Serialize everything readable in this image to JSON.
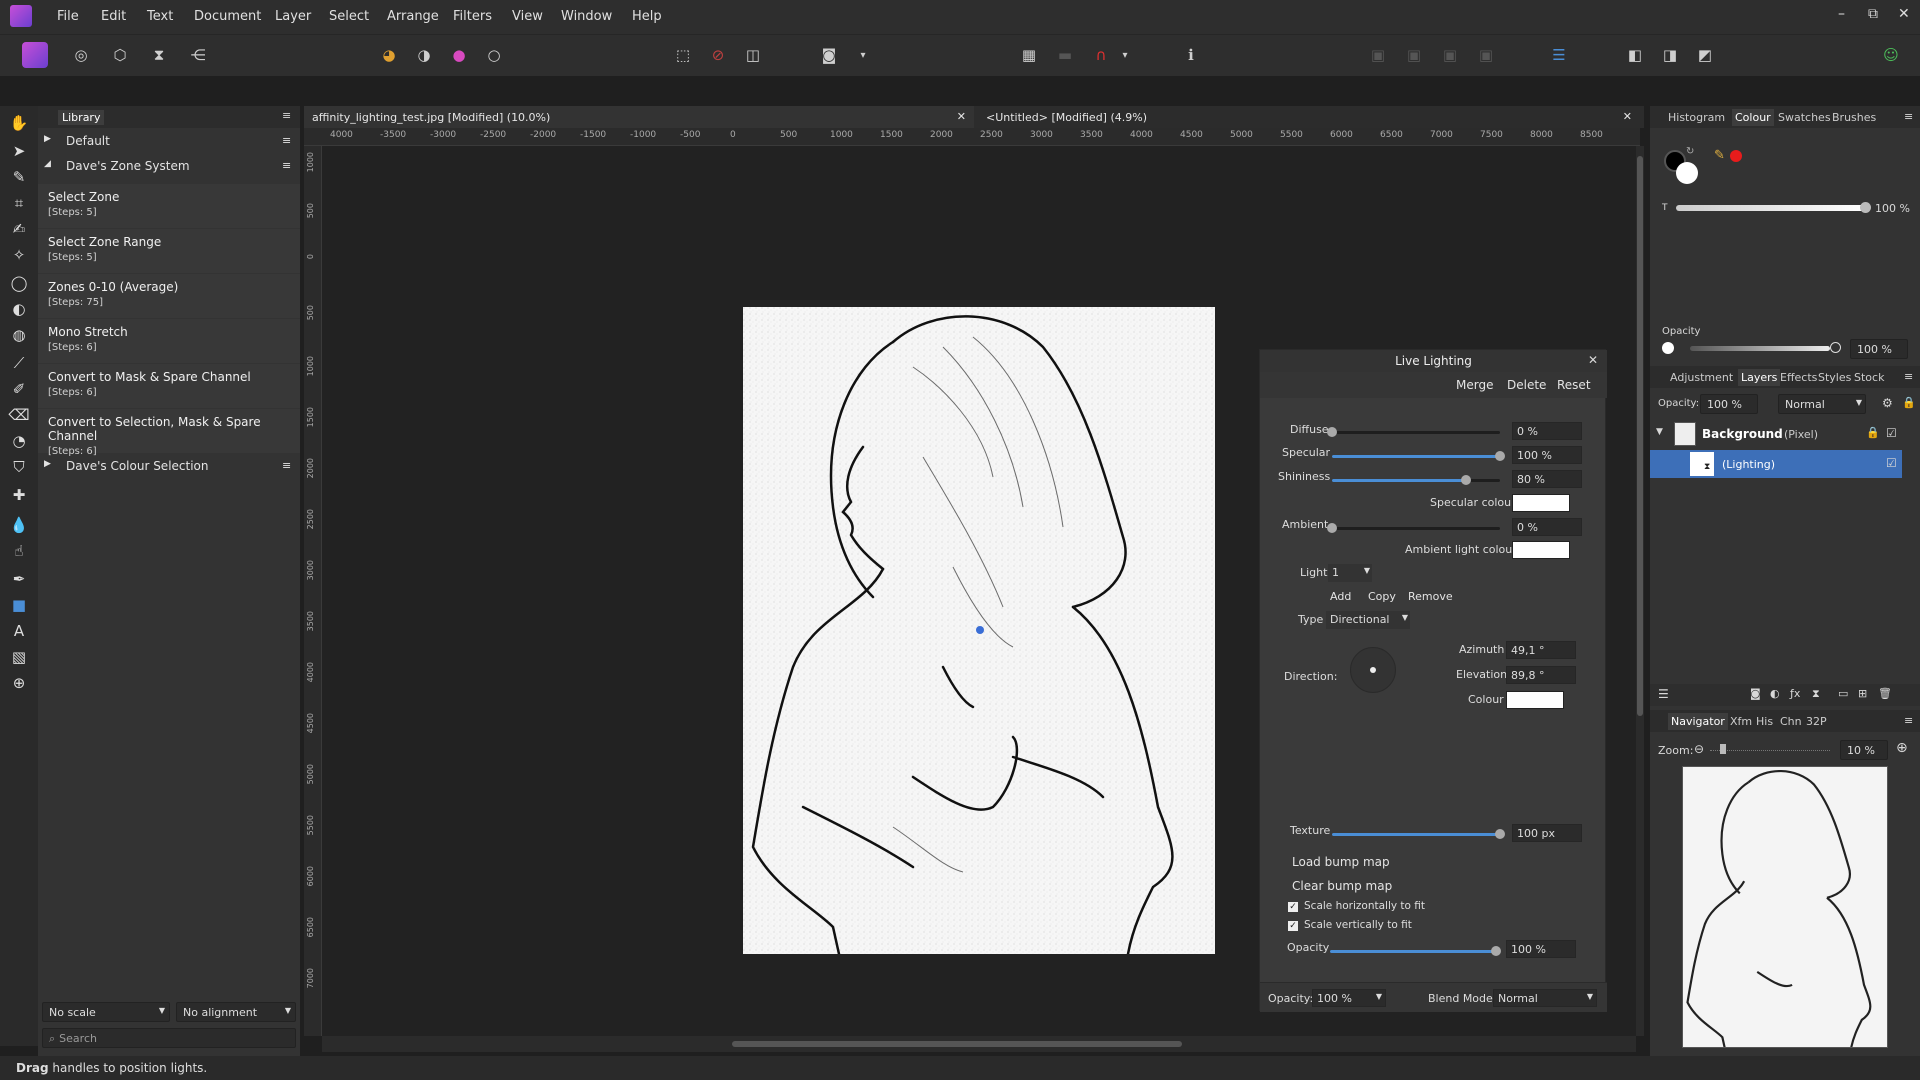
{
  "menu": [
    "File",
    "Edit",
    "Text",
    "Document",
    "Layer",
    "Select",
    "Arrange",
    "Filters",
    "View",
    "Window",
    "Help"
  ],
  "window_controls": [
    "–",
    "⧉",
    "✕"
  ],
  "library": {
    "title": "Library",
    "groups": {
      "default": "Default",
      "daves_zone": "Dave's Zone System",
      "daves_colour": "Dave's Colour Selection"
    },
    "macros": [
      {
        "name": "Select Zone",
        "steps": "[Steps: 5]"
      },
      {
        "name": "Select Zone Range",
        "steps": "[Steps: 5]"
      },
      {
        "name": "Zones 0-10 (Average)",
        "steps": "[Steps: 75]"
      },
      {
        "name": "Mono Stretch",
        "steps": "[Steps: 6]"
      },
      {
        "name": "Convert to Mask & Spare Channel",
        "steps": "[Steps: 6]"
      },
      {
        "name": "Convert to Selection, Mask & Spare Channel",
        "steps": "[Steps: 6]"
      }
    ],
    "scale_select": "No scale",
    "alignment_select": "No alignment",
    "search_placeholder": "Search"
  },
  "doc_tabs": [
    {
      "label": "affinity_lighting_test.jpg [Modified] (10.0%)"
    },
    {
      "label": "<Untitled> [Modified] (4.9%)"
    }
  ],
  "ruler_h_labels": [
    "4000",
    "-3500",
    "-3000",
    "-2500",
    "-2000",
    "-1500",
    "-1000",
    "-500",
    "0",
    "500",
    "1000",
    "1500",
    "2000",
    "2500",
    "3000",
    "3500",
    "4000",
    "4500",
    "5000",
    "5500",
    "6000",
    "6500",
    "7000",
    "7500",
    "8000",
    "8500"
  ],
  "ruler_v_labels": [
    "1000",
    "500",
    "0",
    "500",
    "1000",
    "1500",
    "2000",
    "2500",
    "3000",
    "3500",
    "4000",
    "4500",
    "5000",
    "5500",
    "6000",
    "6500",
    "7000"
  ],
  "live_lighting": {
    "title": "Live Lighting",
    "merge": "Merge",
    "delete": "Delete",
    "reset": "Reset",
    "diffuse_label": "Diffuse",
    "diffuse": "0 %",
    "diffuse_level": 0,
    "specular_label": "Specular",
    "specular": "100 %",
    "specular_level": 1.0,
    "shininess_label": "Shininess",
    "shininess": "80 %",
    "shininess_level": 0.8,
    "specular_colour_label": "Specular colour",
    "ambient_label": "Ambient",
    "ambient": "0 %",
    "ambient_level": 0,
    "ambient_colour_label": "Ambient light colour",
    "light_label": "Light",
    "light_value": "1",
    "add": "Add",
    "copy": "Copy",
    "remove": "Remove",
    "type_label": "Type",
    "type_value": "Directional",
    "direction_label": "Direction:",
    "azimuth_label": "Azimuth",
    "azimuth": "49,1 °",
    "elevation_label": "Elevation",
    "elevation": "89,8 °",
    "colour_label": "Colour",
    "texture_label": "Texture",
    "texture": "100 px",
    "texture_level": 1.0,
    "load_bump": "Load bump map",
    "clear_bump": "Clear bump map",
    "scale_h": "Scale horizontally to fit",
    "scale_v": "Scale vertically to fit",
    "opacity_label": "Opacity",
    "opacity": "100 %",
    "opacity_level": 1.0,
    "footer_opacity_label": "Opacity:",
    "footer_opacity": "100 %",
    "blend_label": "Blend Mode:",
    "blend_value": "Normal"
  },
  "colour_panel": {
    "tabs": [
      "Histogram",
      "Colour",
      "Swatches",
      "Brushes"
    ],
    "active_tab": "Colour",
    "t_label": "T",
    "t_value": "100 %",
    "opacity_label": "Opacity",
    "opacity_value": "100 %",
    "accent": "#e81c1c"
  },
  "layers_panel": {
    "tabs": [
      "Adjustment",
      "Layers",
      "Effects",
      "Styles",
      "Stock"
    ],
    "active_tab": "Layers",
    "opacity_label": "Opacity:",
    "opacity_value": "100 %",
    "blend": "Normal",
    "layers": [
      {
        "name": "Background",
        "type": "(Pixel)"
      },
      {
        "name": "",
        "type": "(Lighting)"
      }
    ],
    "selection_color": "#3d6fb8"
  },
  "navigator_panel": {
    "tabs": [
      "Navigator",
      "Xfm",
      "His",
      "Chn",
      "32P"
    ],
    "active_tab": "Navigator",
    "zoom_label": "Zoom:",
    "zoom_value": "10 %"
  },
  "status": {
    "bold": "Drag",
    "text": " handles to position lights."
  }
}
